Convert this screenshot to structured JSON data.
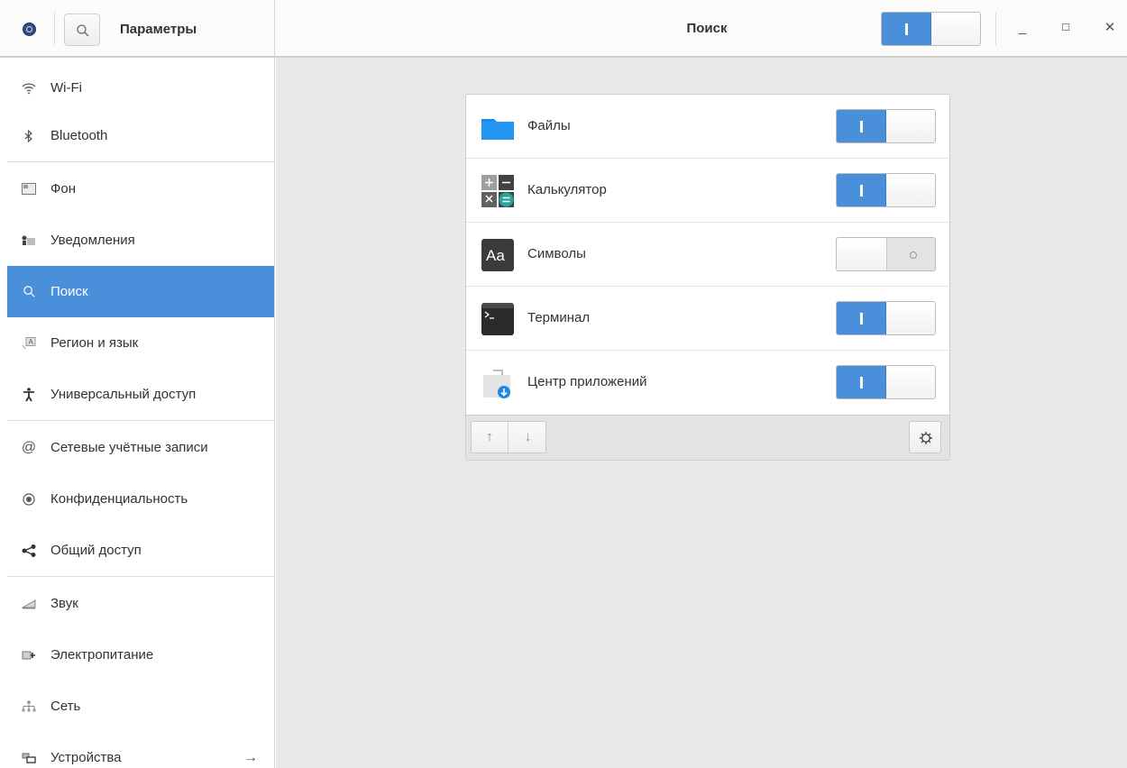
{
  "header": {
    "app_title": "Параметры",
    "page_title": "Поиск",
    "search_enabled": true,
    "window_controls": [
      "minimize-icon",
      "maximize-icon",
      "close-icon"
    ]
  },
  "sidebar": {
    "items": [
      {
        "label": "Wi-Fi",
        "icon": "wifi-icon"
      },
      {
        "label": "Bluetooth",
        "icon": "bluetooth-icon"
      },
      {
        "label": "Фон",
        "icon": "background-icon"
      },
      {
        "label": "Уведомления",
        "icon": "notifications-icon"
      },
      {
        "label": "Поиск",
        "icon": "search-icon",
        "active": true
      },
      {
        "label": "Регион и язык",
        "icon": "region-language-icon"
      },
      {
        "label": "Универсальный доступ",
        "icon": "accessibility-icon"
      },
      {
        "label": "Сетевые учётные записи",
        "icon": "online-accounts-icon"
      },
      {
        "label": "Конфиденциальность",
        "icon": "privacy-icon"
      },
      {
        "label": "Общий доступ",
        "icon": "share-icon"
      },
      {
        "label": "Звук",
        "icon": "sound-icon"
      },
      {
        "label": "Электропитание",
        "icon": "power-icon"
      },
      {
        "label": "Сеть",
        "icon": "network-icon"
      },
      {
        "label": "Устройства",
        "icon": "devices-icon",
        "has_submenu": true
      }
    ]
  },
  "search_providers": [
    {
      "label": "Файлы",
      "icon": "files-folder-icon",
      "enabled": true
    },
    {
      "label": "Калькулятор",
      "icon": "calculator-icon",
      "enabled": true
    },
    {
      "label": "Символы",
      "icon": "characters-icon",
      "icon_text": "Aa",
      "enabled": false
    },
    {
      "label": "Терминал",
      "icon": "terminal-icon",
      "enabled": true
    },
    {
      "label": "Центр приложений",
      "icon": "software-center-icon",
      "enabled": true
    }
  ],
  "footer": {
    "up_icon": "arrow-up-icon",
    "down_icon": "arrow-down-icon",
    "settings_icon": "gear-icon"
  },
  "colors": {
    "accent": "#4a8fda",
    "background": "#e8e8e8"
  }
}
